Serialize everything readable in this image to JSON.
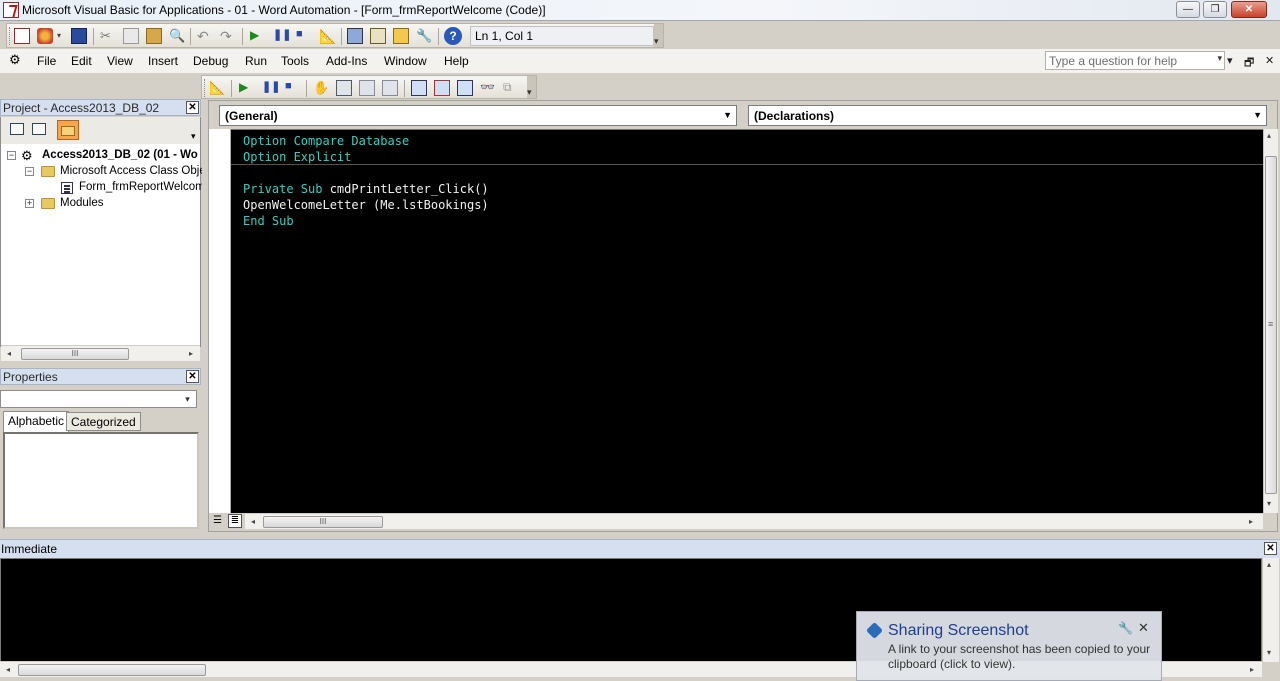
{
  "window": {
    "title": "Microsoft Visual Basic for Applications - 01 - Word Automation - [Form_frmReportWelcome (Code)]",
    "controls": {
      "minimize": "—",
      "restore": "❐",
      "close": "✕"
    }
  },
  "standard_toolbar": {
    "position_box": "Ln 1, Col 1"
  },
  "menubar": {
    "items": [
      "File",
      "Edit",
      "View",
      "Insert",
      "Debug",
      "Run",
      "Tools",
      "Add-Ins",
      "Window",
      "Help"
    ],
    "help_placeholder": "Type a question for help",
    "mdi_controls": {
      "minimize": "▾",
      "restore": "🗗",
      "close": "✕"
    }
  },
  "project_pane": {
    "title": "Project - Access2013_DB_02",
    "tree": {
      "root": "Access2013_DB_02 (01 - Wo",
      "class_objects": "Microsoft Access Class Objec",
      "form": "Form_frmReportWelcome",
      "modules": "Modules"
    },
    "scroll_thumb_grip": "III"
  },
  "properties_pane": {
    "title": "Properties",
    "tabs": [
      "Alphabetic",
      "Categorized"
    ],
    "active_tab": "Alphabetic"
  },
  "code_window": {
    "object_combo": "(General)",
    "procedure_combo": "(Declarations)",
    "declarations": [
      {
        "text": "Option Compare Database",
        "kind": "keyword"
      },
      {
        "text": "Option Explicit",
        "kind": "keyword"
      }
    ],
    "procedure": [
      {
        "parts": [
          {
            "text": "Private Sub ",
            "kind": "keyword"
          },
          {
            "text": "cmdPrintLetter_Click()",
            "kind": "text"
          }
        ]
      },
      {
        "parts": [
          {
            "text": "OpenWelcomeLetter (Me.lstBookings)",
            "kind": "text"
          }
        ]
      },
      {
        "parts": [
          {
            "text": "End Sub",
            "kind": "keyword"
          }
        ]
      }
    ],
    "scroll_thumb_grip": "III",
    "colors": {
      "keyword": "#36cfc0",
      "text": "#f2f2f2",
      "background": "#000000"
    }
  },
  "immediate_pane": {
    "title": "Immediate"
  },
  "notification": {
    "title": "Sharing Screenshot",
    "body": "A link to your screenshot has been copied to your clipboard (click to view).",
    "pin_icon": "🔧",
    "close_icon": "✕"
  }
}
